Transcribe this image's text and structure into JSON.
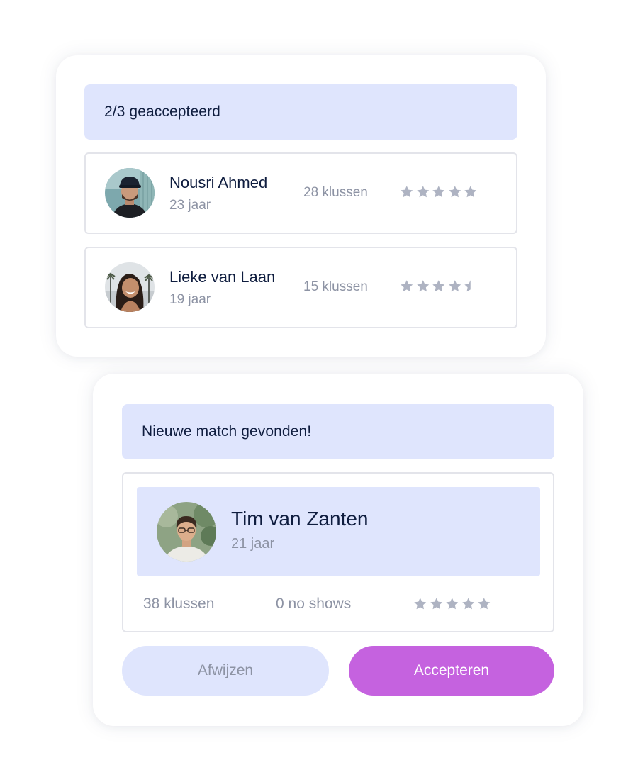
{
  "accepted_card": {
    "banner_text": "2/3 geaccepteerd",
    "people": [
      {
        "name": "Nousri Ahmed",
        "age": "23 jaar",
        "jobs": "28 klussen",
        "rating": 5,
        "avatar_icon": "man-with-cap-photo"
      },
      {
        "name": "Lieke van Laan",
        "age": "19 jaar",
        "jobs": "15 klussen",
        "rating": 4.5,
        "avatar_icon": "smiling-woman-photo"
      }
    ]
  },
  "match_card": {
    "banner_text": "Nieuwe match gevonden!",
    "person": {
      "name": "Tim van Zanten",
      "age": "21 jaar",
      "jobs": "38 klussen",
      "no_shows": "0 no shows",
      "rating": 5,
      "avatar_icon": "young-man-photo"
    },
    "reject_label": "Afwijzen",
    "accept_label": "Accepteren"
  },
  "colors": {
    "banner_bg": "#dfe5fd",
    "text_dark": "#0f1d3f",
    "text_muted": "#8d93a4",
    "star": "#aeb3c2",
    "accept": "#c562df",
    "border": "#e3e4ea"
  }
}
